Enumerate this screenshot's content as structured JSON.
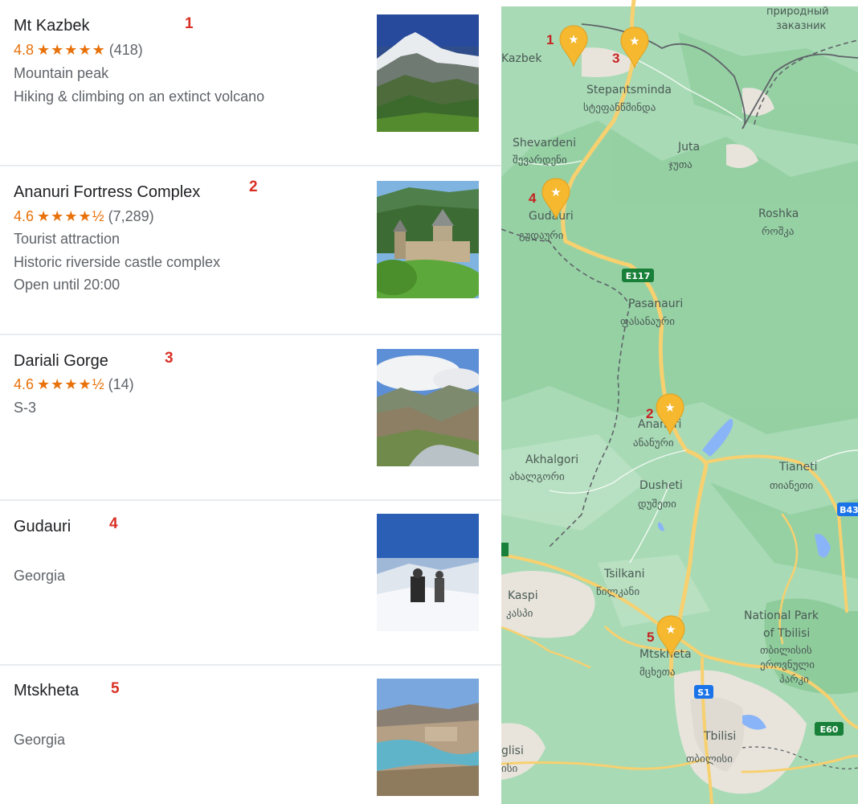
{
  "places": [
    {
      "name": "Mt Kazbek",
      "marker": "1",
      "rating": "4.8",
      "stars": "★★★★★",
      "reviews": "(418)",
      "type": "Mountain peak",
      "description": "Hiking & climbing on an extinct volcano",
      "hours": ""
    },
    {
      "name": "Ananuri Fortress Complex",
      "marker": "2",
      "rating": "4.6",
      "stars": "★★★★½",
      "reviews": "(7,289)",
      "type": "Tourist attraction",
      "description": "Historic riverside castle complex",
      "hours": "Open until 20:00"
    },
    {
      "name": "Dariali Gorge",
      "marker": "3",
      "rating": "4.6",
      "stars": "★★★★½",
      "reviews": "(14)",
      "type": "S-3",
      "description": "",
      "hours": ""
    },
    {
      "name": "Gudauri",
      "marker": "4",
      "rating": "",
      "stars": "",
      "reviews": "",
      "type": "Georgia",
      "description": "",
      "hours": ""
    },
    {
      "name": "Mtskheta",
      "marker": "5",
      "rating": "",
      "stars": "",
      "reviews": "",
      "type": "Georgia",
      "description": "",
      "hours": ""
    }
  ],
  "map": {
    "labels": {
      "reserve_ru": "природный",
      "reserve_ru2": "заказник",
      "kazbek": "Kazbek",
      "stepantsminda": "Stepantsminda",
      "stepantsminda_ka": "სტეფანწმინდა",
      "shevardeni": "Shevardeni",
      "shevardeni_ka": "შევარდენი",
      "juta": "Juta",
      "juta_ka": "ჯუთა",
      "gudauri": "Gudauri",
      "gudauri_ka": "გუდაური",
      "roshka": "Roshka",
      "roshka_ka": "როშკა",
      "e117": "E117",
      "pasanauri": "Pasanauri",
      "pasanauri_ka": "ფასანაური",
      "ananuri": "Ananuri",
      "ananuri_ka": "ანანური",
      "akhalgori": "Akhalgori",
      "akhalgori_ka": "ახალგორი",
      "dusheti": "Dusheti",
      "dusheti_ka": "დუშეთი",
      "tianeti": "Tianeti",
      "tianeti_ka": "თიანეთი",
      "b43": "B43",
      "tsilkani": "Tsilkani",
      "tsilkani_ka": "წილკანი",
      "kaspi": "Kaspi",
      "kaspi_ka": "კასპი",
      "national_park": "National Park",
      "of_tbilisi": "of Tbilisi",
      "np_ka1": "თბილისის",
      "np_ka2": "ეროვნული",
      "np_ka3": "პარკი",
      "mtskheta": "Mtskheta",
      "mtskheta_ka": "მცხეთა",
      "s1": "S1",
      "tbilisi": "Tbilisi",
      "tbilisi_ka": "თბილისი",
      "e60": "E60",
      "gorisi": "glisi",
      "gorisi_ka": "ისი"
    },
    "colors": {
      "land": "#a8dab5",
      "terrain": "#93cfa2",
      "road": "#f7d070",
      "border": "#5f6368",
      "water": "#8ab4f8",
      "urban": "#e8e4dc",
      "pin": "#f5b82e"
    }
  }
}
